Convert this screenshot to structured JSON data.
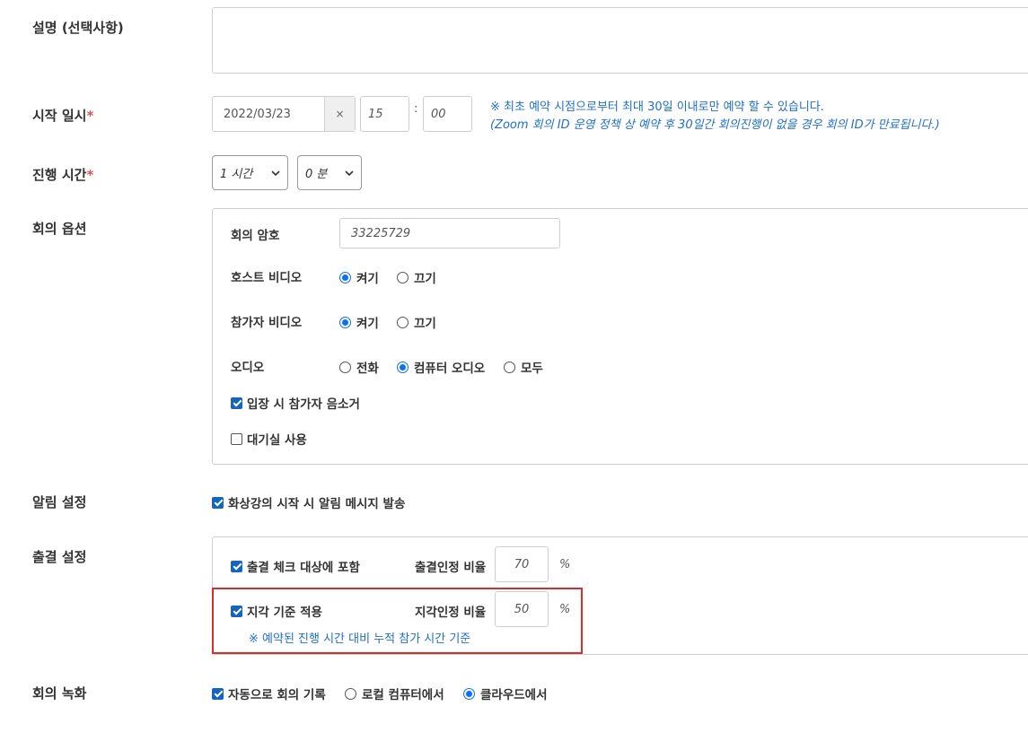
{
  "description": {
    "label": "설명 (선택사항)",
    "value": ""
  },
  "start": {
    "label": "시작 일시",
    "required_mark": "*",
    "date": "2022/03/23",
    "clear": "×",
    "hour": "15",
    "colon": ":",
    "minute": "00",
    "note1": "※ 최초 예약 시점으로부터 최대 30일 이내로만 예약 할 수 있습니다.",
    "note2": "(Zoom 회의 ID 운영 정책 상 예약 후 30일간 회의진행이 없을 경우 회의 ID가 만료됩니다.)"
  },
  "duration": {
    "label": "진행 시간",
    "required_mark": "*",
    "hours": "1 시간",
    "minutes": "0 분"
  },
  "meeting_options": {
    "label": "회의 옵션",
    "password_label": "회의 암호",
    "password_value": "33225729",
    "host_video_label": "호스트 비디오",
    "participant_video_label": "참가자 비디오",
    "on": "켜기",
    "off": "끄기",
    "audio_label": "오디오",
    "audio_phone": "전화",
    "audio_computer": "컴퓨터 오디오",
    "audio_both": "모두",
    "mute_on_entry": "입장 시 참가자 음소거",
    "waiting_room": "대기실 사용"
  },
  "notification": {
    "label": "알림 설정",
    "option": "화상강의 시작 시 알림 메시지 발송"
  },
  "attendance": {
    "label": "출결 설정",
    "include": "출결 체크 대상에 포함",
    "attend_ratio_label": "출결인정 비율",
    "attend_ratio": "70",
    "percent": "%",
    "late_apply": "지각 기준 적용",
    "late_ratio_label": "지각인정 비율",
    "late_ratio": "50",
    "late_note": "※ 예약된 진행 시간 대비 누적 참가 시간 기준"
  },
  "recording": {
    "label": "회의 녹화",
    "auto": "자동으로 회의 기록",
    "local": "로컬 컴퓨터에서",
    "cloud": "클라우드에서"
  },
  "colors": {
    "accent": "#1565c0",
    "note": "#1f6fc5",
    "required": "#d9534f",
    "highlight": "#d32f2f"
  }
}
